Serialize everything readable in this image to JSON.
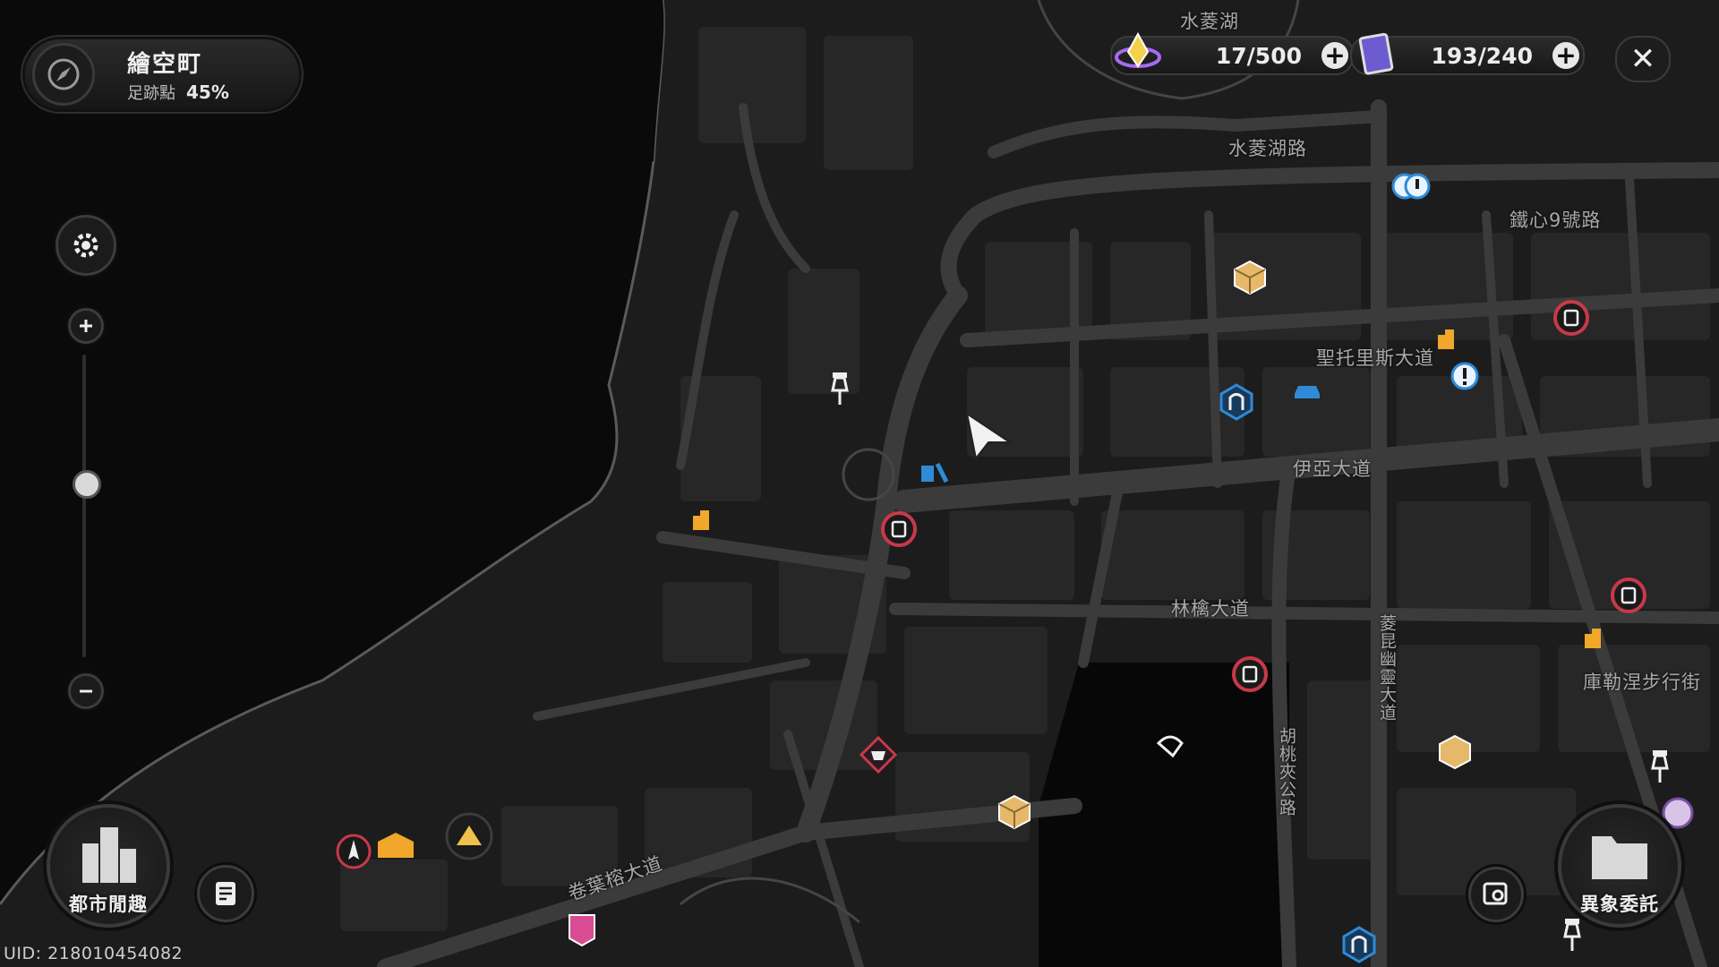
{
  "location": {
    "title": "繪空町",
    "sub_label": "足跡點",
    "progress": "45%",
    "icon": "compass-icon"
  },
  "zoom": {
    "level": 0.58
  },
  "currencies": [
    {
      "icon": "energy-crystal-icon",
      "value": "17/500"
    },
    {
      "icon": "card-pack-icon",
      "value": "193/240"
    }
  ],
  "close_label": "✕",
  "map_labels": {
    "lake": "水菱湖",
    "lake_road": "水菱湖路",
    "iron_heart": "鐵心9號路",
    "st_tories": "聖托里斯大道",
    "iya": "伊亞大道",
    "linqin": "林檎大道",
    "kuler": "庫勒涅步行街",
    "lingkun": "菱昆幽靈大道",
    "hutao": "胡桃夾公路",
    "banyan": "卷葉榕大道"
  },
  "buttons": {
    "city_fun": "都市閒趣",
    "anomaly": "異象委託"
  },
  "uid": "UID: 218010454082",
  "colors": {
    "marker_red": "#c8394a",
    "marker_blue": "#2f8bd6",
    "marker_orange": "#f0a72a",
    "marker_gold": "#e6b86a"
  }
}
